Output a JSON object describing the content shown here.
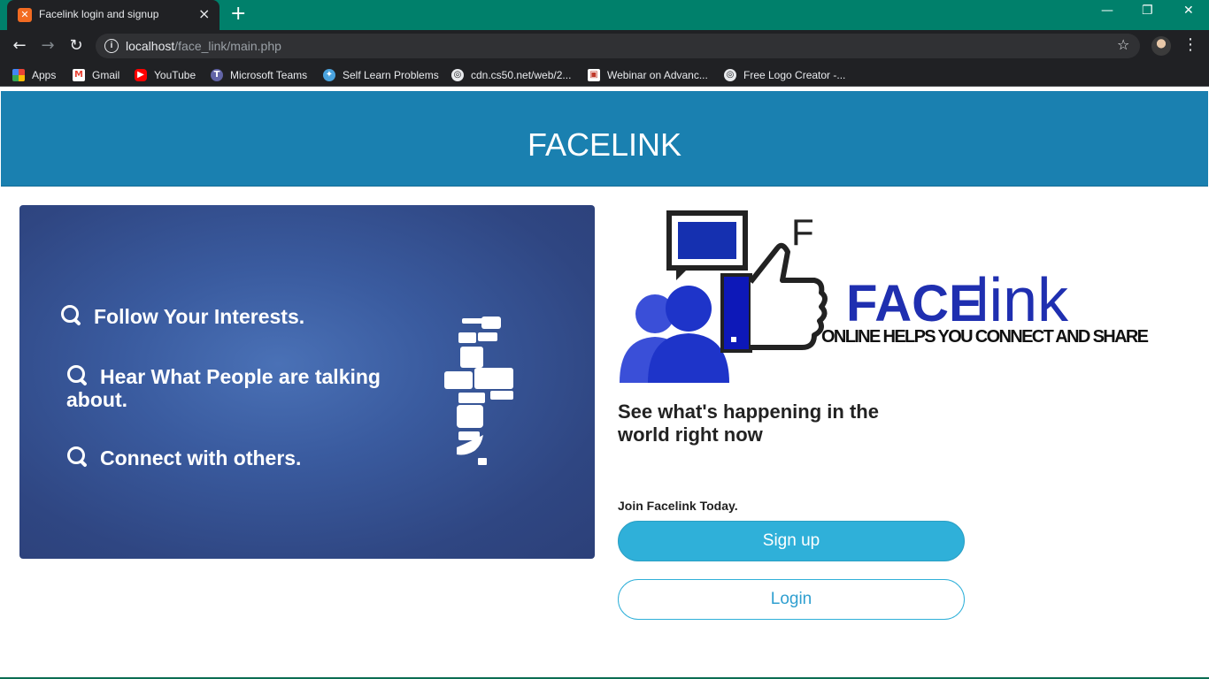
{
  "browser": {
    "tab_title": "Facelink login and signup",
    "tab_close": "×",
    "new_tab": "+",
    "url_host": "localhost",
    "url_path": "/face_link/main.php",
    "window_controls": {
      "minimize": "—",
      "restore": "❐",
      "close": "✕"
    }
  },
  "bookmarks": [
    {
      "label": "Apps",
      "icon": "apps-grid-icon",
      "color": "#ea4335"
    },
    {
      "label": "Gmail",
      "icon": "gmail-icon",
      "color": "#ea4335"
    },
    {
      "label": "YouTube",
      "icon": "youtube-icon",
      "color": "#ff0000"
    },
    {
      "label": "Microsoft Teams",
      "icon": "teams-icon",
      "color": "#6264a7"
    },
    {
      "label": "Self Learn Problems",
      "icon": "self-learn-icon",
      "color": "#4aa3df"
    },
    {
      "label": "cdn.cs50.net/web/2...",
      "icon": "globe-icon",
      "color": "#e8eaed"
    },
    {
      "label": "Webinar on Advanc...",
      "icon": "webinar-icon",
      "color": "#c0392b"
    },
    {
      "label": "Free Logo Creator -...",
      "icon": "globe-icon",
      "color": "#e8eaed"
    }
  ],
  "header": {
    "title": "FACELINK"
  },
  "hero": {
    "features": [
      "Follow Your Interests.",
      "Hear What People are talking about.",
      "Connect with others."
    ]
  },
  "logo": {
    "face": "FACE",
    "link": "link",
    "f_letter": "F",
    "slogan": "ONLINE HELPS YOU CONNECT AND SHARE"
  },
  "main": {
    "tagline": "See what's happening in the world right now",
    "join_text": "Join Facelink Today.",
    "signup_label": "Sign up",
    "login_label": "Login"
  },
  "colors": {
    "header_bg": "#1a80b0",
    "hero_bg": "#3a5b9f",
    "signup_bg": "#2fb0d9",
    "logo_blue": "#1f2fb0"
  }
}
